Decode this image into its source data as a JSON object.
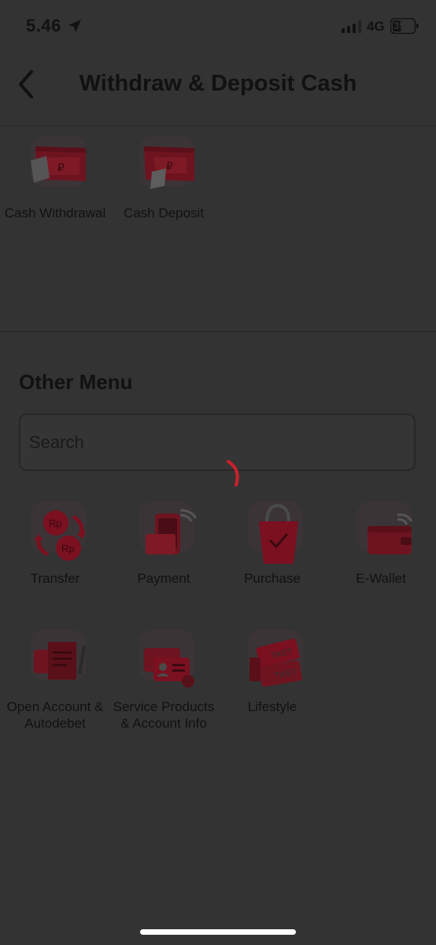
{
  "status_bar": {
    "time": "5.46",
    "network": "4G",
    "battery": "35"
  },
  "header": {
    "title": "Withdraw & Deposit Cash"
  },
  "primary_menu": [
    {
      "label": "Cash Withdrawal",
      "icon": "cash-withdrawal-icon"
    },
    {
      "label": "Cash Deposit",
      "icon": "cash-deposit-icon"
    }
  ],
  "other_menu": {
    "title": "Other Menu",
    "search_placeholder": "Search",
    "items": [
      {
        "label": "Transfer",
        "icon": "transfer-icon"
      },
      {
        "label": "Payment",
        "icon": "payment-icon"
      },
      {
        "label": "Purchase",
        "icon": "purchase-icon"
      },
      {
        "label": "E-Wallet",
        "icon": "e-wallet-icon"
      },
      {
        "label": "Open Account & Autodebet",
        "icon": "open-account-icon"
      },
      {
        "label": "Service Products & Account Info",
        "icon": "account-info-icon"
      },
      {
        "label": "Lifestyle",
        "icon": "lifestyle-icon"
      }
    ]
  },
  "icon_text": {
    "currency": "Rp",
    "ticket": "TIKET"
  },
  "colors": {
    "overlay": "#333333",
    "accent": "#7a1020",
    "spinner": "#d0202c"
  }
}
